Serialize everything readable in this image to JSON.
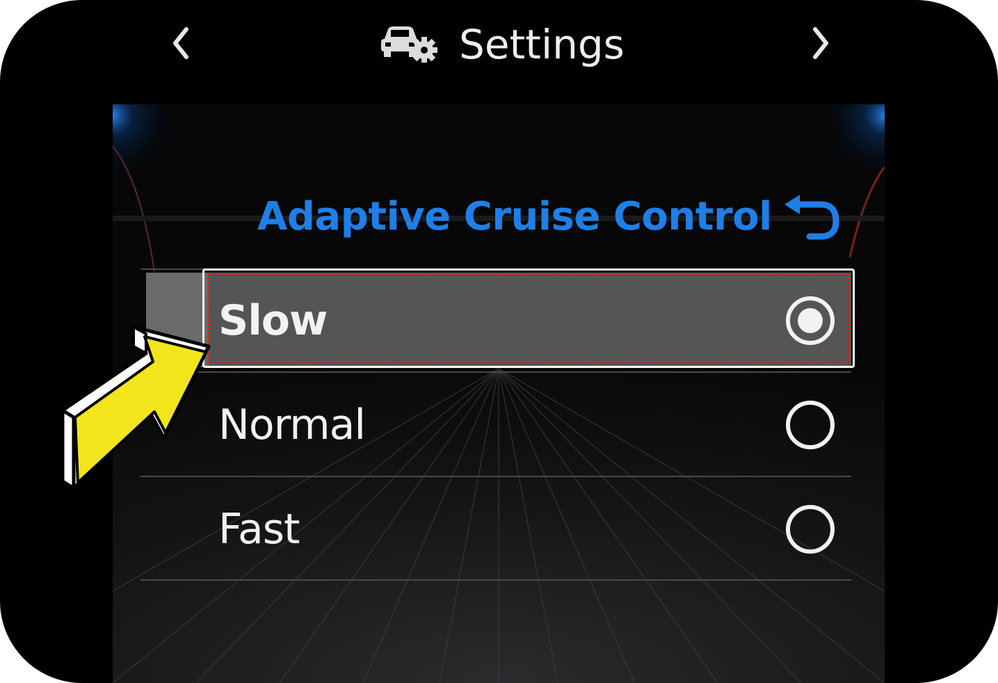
{
  "header": {
    "title": "Settings",
    "prev_icon": "chevron-left-icon",
    "next_icon": "chevron-right-icon",
    "settings_icon": "car-settings-icon"
  },
  "page": {
    "title": "Adaptive Cruise Control",
    "back_icon": "back-arrow-icon"
  },
  "options": [
    {
      "label": "Slow",
      "selected": true
    },
    {
      "label": "Normal",
      "selected": false
    },
    {
      "label": "Fast",
      "selected": false
    }
  ],
  "annotation": {
    "pointer_color": "#f2e51c",
    "highlight_color": "#e21c1c"
  },
  "colors": {
    "accent": "#1e7fe8",
    "selected_row": "#555555"
  }
}
